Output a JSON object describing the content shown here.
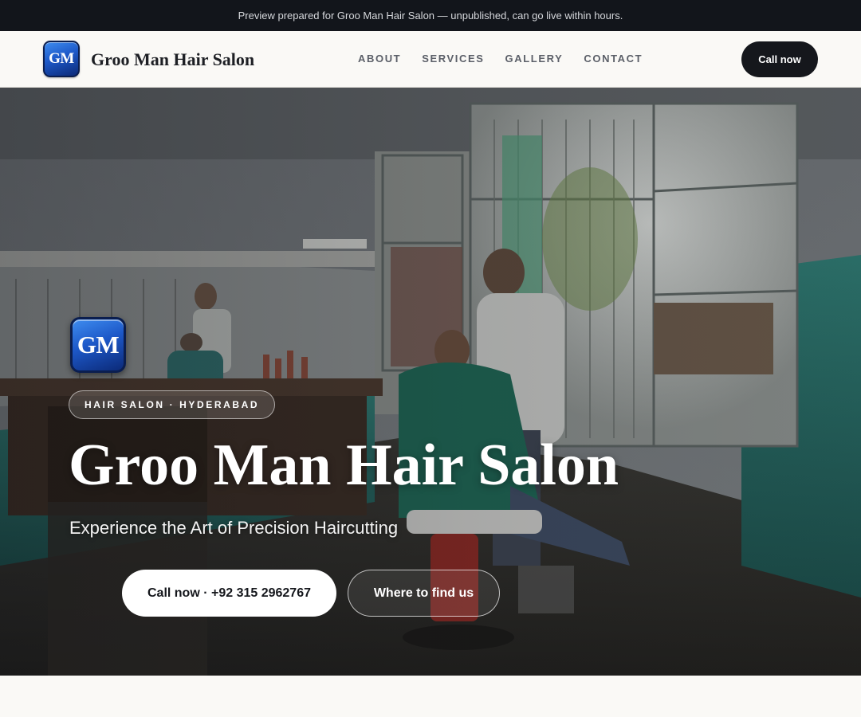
{
  "preview_bar": {
    "text": "Preview prepared for Groo Man Hair Salon — unpublished, can go live within hours."
  },
  "header": {
    "logo_text": "GM",
    "brand_name": "Groo Man Hair Salon",
    "nav": [
      "ABOUT",
      "SERVICES",
      "GALLERY",
      "CONTACT"
    ],
    "cta_label": "Call now"
  },
  "hero": {
    "logo_text": "GM",
    "badge": "HAIR SALON · HYDERABAD",
    "title": "Groo Man Hair Salon",
    "subtitle": "Experience the Art of Precision Haircutting",
    "primary_button": "Call now · +92 315 2962767",
    "secondary_button": "Where to find us"
  },
  "colors": {
    "top_bar": "#12151b",
    "cta_dark": "#15171c",
    "page_background": "#faf9f6",
    "logo_blue": "#1d58c8"
  }
}
